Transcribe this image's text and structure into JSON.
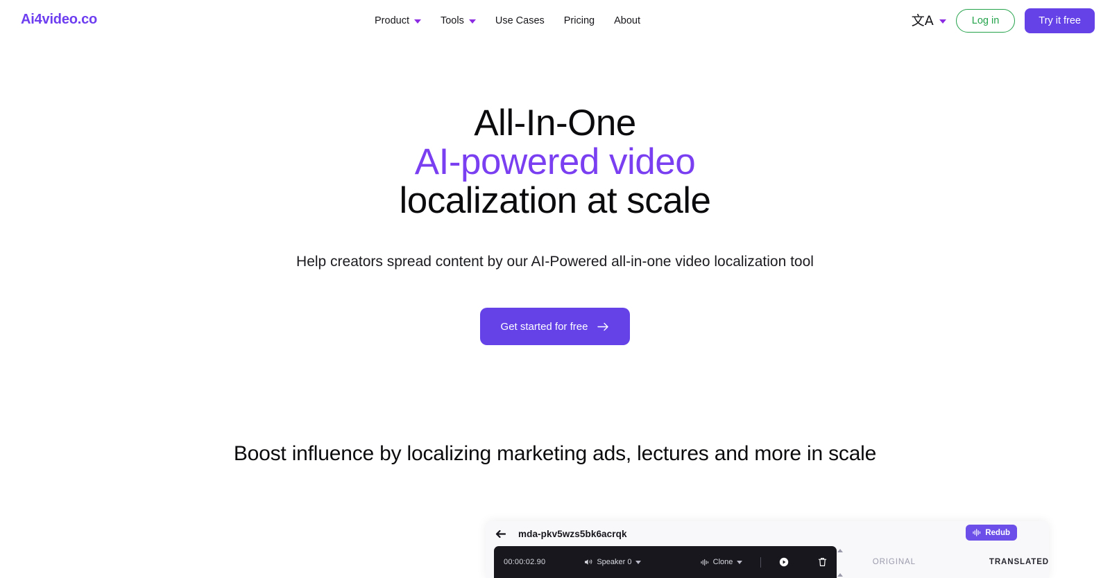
{
  "header": {
    "logo": "Ai4video.co",
    "nav": [
      {
        "label": "Product",
        "has_dropdown": true
      },
      {
        "label": "Tools",
        "has_dropdown": true
      },
      {
        "label": "Use Cases",
        "has_dropdown": false
      },
      {
        "label": "Pricing",
        "has_dropdown": false
      },
      {
        "label": "About",
        "has_dropdown": false
      }
    ],
    "language_icon": "translate-icon",
    "language_glyph": "文A",
    "login_label": "Log in",
    "try_label": "Try it free"
  },
  "hero": {
    "line1": "All-In-One",
    "line2_accent": "AI-powered video",
    "line3": "localization at scale",
    "subtitle": "Help creators spread content by our AI-Powered all-in-one video localization tool",
    "cta_label": "Get started for free",
    "cta_icon": "arrow-right-icon"
  },
  "section": {
    "heading": "Boost influence by localizing marketing ads, lectures and more in scale"
  },
  "editor": {
    "back_icon": "back-arrow-icon",
    "title": "mda-pkv5wzs5bk6acrqk",
    "redub_label": "Redub",
    "redub_icon": "waveform-icon",
    "timeline": {
      "timecode": "00:00:02.90",
      "speaker_label": "Speaker 0",
      "speaker_icon": "speaker-icon",
      "voice_label": "Clone",
      "voice_icon": "waveform-icon",
      "play_icon": "play-circle-icon",
      "delete_icon": "trash-icon"
    },
    "columns": {
      "original": "ORIGINAL",
      "translated": "TRANSLATED"
    }
  },
  "colors": {
    "brand_purple": "#6442e8",
    "heading_accent": "#7b3ff2",
    "login_green": "#23a24a",
    "caret_purple": "#8b2be2",
    "editor_dark": "#17171d"
  }
}
